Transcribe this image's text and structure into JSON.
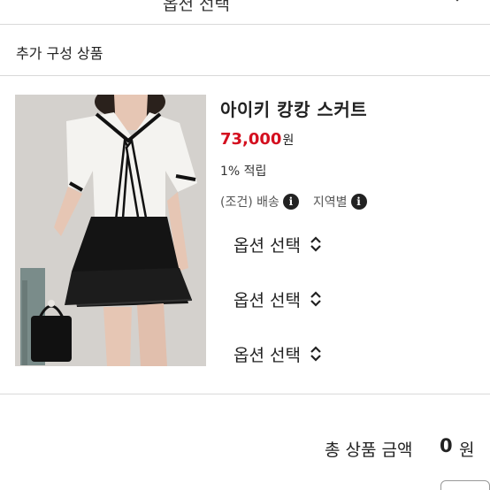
{
  "top_select": {
    "label": "옵션 선택"
  },
  "section": {
    "title": "추가 구성 상품"
  },
  "product": {
    "name": "아이키 캉캉 스커트",
    "price": "73,000",
    "price_unit": "원",
    "points": "1% 적립",
    "shipping_label": "(조건) 배송",
    "region_label": "지역별",
    "info_icon_glyph": "i",
    "options": [
      {
        "label": "옵션 선택"
      },
      {
        "label": "옵션 선택"
      },
      {
        "label": "옵션 선택"
      }
    ]
  },
  "total": {
    "label": "총 상품 금액",
    "amount": "0",
    "unit": "원"
  },
  "colors": {
    "price": "#d40f1f",
    "divider": "#d9d9d9",
    "text": "#222222"
  },
  "icons": [
    "chevron-down-icon",
    "info-icon",
    "updown-chevron-icon"
  ]
}
